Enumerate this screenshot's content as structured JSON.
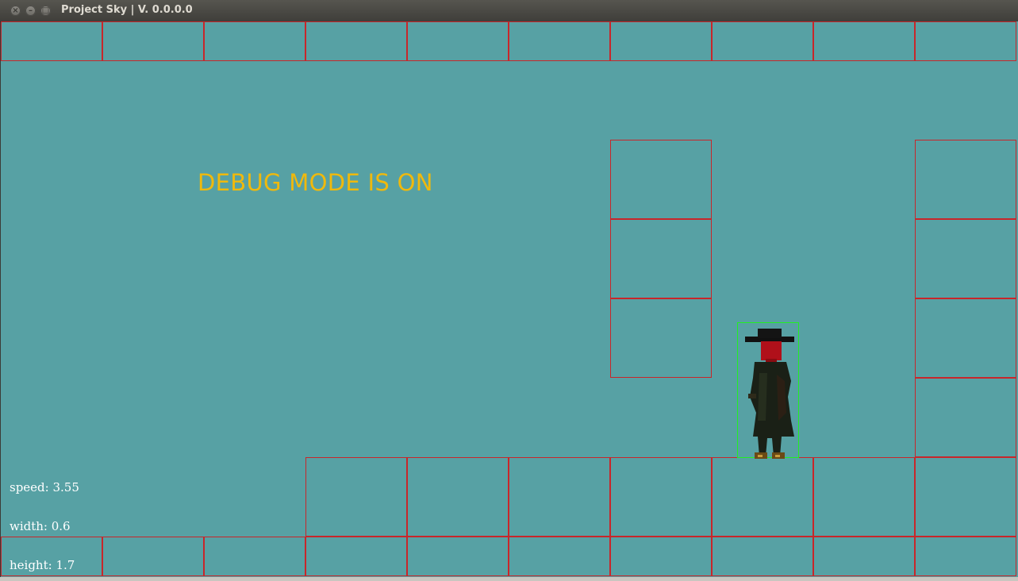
{
  "window": {
    "title": "Project Sky | V. 0.0.0.0",
    "buttons": {
      "close_icon": "close-icon",
      "minimize_icon": "minimize-icon",
      "maximize_icon": "maximize-icon"
    }
  },
  "game": {
    "background_color": "#57a1a4",
    "tile_border_color": "#c8262a",
    "debug_banner": "DEBUG MODE IS ON",
    "debug_color": "#f0b90c",
    "hitbox_color": "#22ee22"
  },
  "stats": {
    "speed": "speed: 3.55",
    "width": "width: 0.6",
    "height": "height: 1.7"
  }
}
